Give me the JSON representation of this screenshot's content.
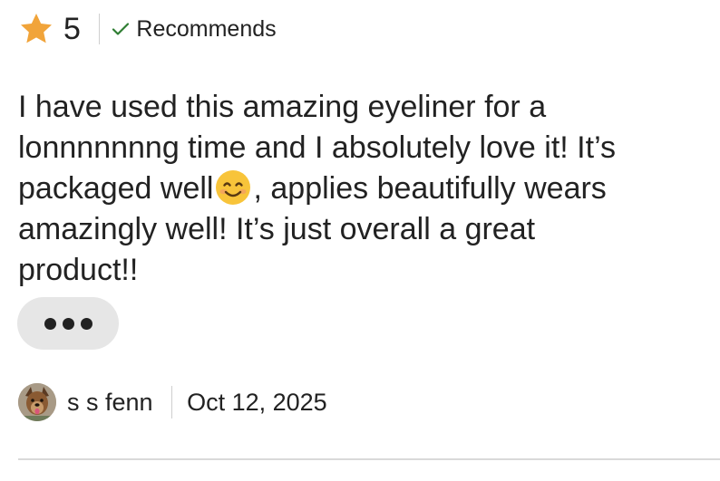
{
  "review": {
    "rating": "5",
    "recommends_label": "Recommends",
    "text_lines": [
      "I have used this amazing eyeliner for a",
      "lonnnnnnng time and I absolutely love it! It’s",
      "packaged well",
      ", applies beautifully wears",
      "amazingly well! It’s just overall a great",
      "product!!"
    ],
    "emoji": "smiling-face-emoji",
    "more_button_icon": "more-dots-icon",
    "author_name": "s s fenn",
    "date": "Oct 12, 2025"
  },
  "colors": {
    "star": "#F1A43A",
    "check": "#2E7D32",
    "text": "#222222",
    "more_button_bg": "#E6E6E6",
    "divider": "#D9D9D9"
  },
  "icons": {
    "star": "star-icon",
    "check": "checkmark-icon",
    "avatar": "dog-avatar"
  }
}
